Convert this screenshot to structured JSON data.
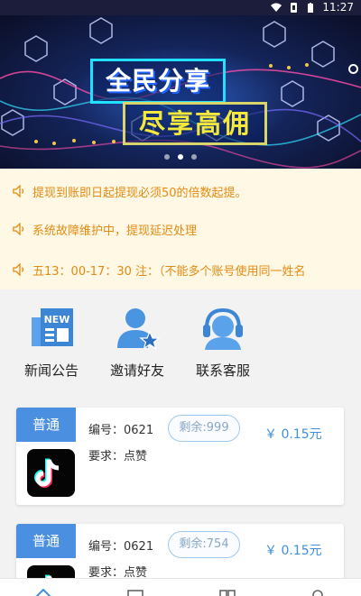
{
  "status_bar": {
    "time": "11:27"
  },
  "banner": {
    "headline": "全民分享",
    "subheadline": "尽享高佣",
    "slides_count": 3,
    "active_slide": 2,
    "colors": {
      "headline_border": "#22e0ff",
      "subheadline_text": "#f4e83a"
    }
  },
  "notices": [
    {
      "icon": "speaker-icon",
      "text": "提现到账即日起提现必须50的倍数起提。"
    },
    {
      "icon": "speaker-icon",
      "text": "系统故障维护中，提现延迟处理"
    },
    {
      "icon": "speaker-icon",
      "text": "五13：00-17：30 注：（不能多个账号使用同一姓名"
    }
  ],
  "quick_links": [
    {
      "icon": "news-icon",
      "label": "新闻公告",
      "icon_text": "NEW"
    },
    {
      "icon": "invite-friend-icon",
      "label": "邀请好友"
    },
    {
      "icon": "customer-service-icon",
      "label": "联系客服"
    }
  ],
  "tasks": [
    {
      "tag": "普通",
      "app_icon": "tiktok-icon",
      "code": "编号：0621",
      "requirement": "要求：点赞",
      "remaining": "剩余:999",
      "price": "￥ 0.15元"
    },
    {
      "tag": "普通",
      "app_icon": "tiktok-icon",
      "code": "编号：0621",
      "requirement": "要求：点赞",
      "remaining": "剩余:754",
      "price": "￥ 0.15元"
    }
  ],
  "tab_bar": {
    "items": [
      "home-icon",
      "task-icon",
      "record-icon",
      "profile-icon"
    ],
    "active": "home-icon",
    "accent_color": "#3f8fe0"
  }
}
